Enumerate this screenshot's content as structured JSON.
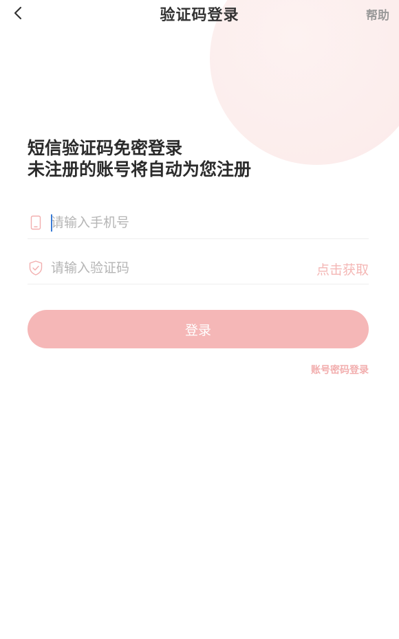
{
  "nav": {
    "title": "验证码登录",
    "help_label": "帮助",
    "back_icon": "chevron-left-icon"
  },
  "headline": {
    "line1": "短信验证码免密登录",
    "line2": "未注册的账号将自动为您注册"
  },
  "phone_field": {
    "placeholder": "请输入手机号",
    "value": "",
    "icon": "phone-icon"
  },
  "code_field": {
    "placeholder": "请输入验证码",
    "value": "",
    "icon": "shield-check-icon",
    "get_code_label": "点击获取"
  },
  "login_button": {
    "label": "登录"
  },
  "password_login_link": "账号密码登录",
  "colors": {
    "accent": "#f5b7b7",
    "accent_text": "#f2aeae",
    "title": "#333333",
    "placeholder": "#b5b5b5",
    "decor_circle": "#fcedec"
  }
}
